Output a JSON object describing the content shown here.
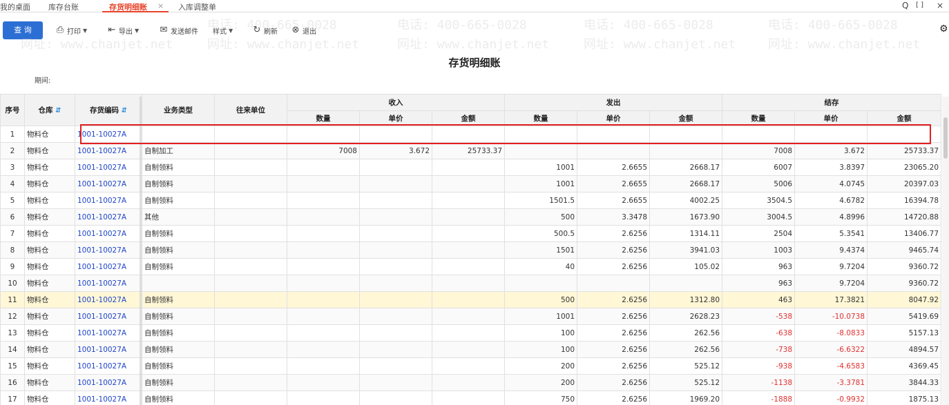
{
  "tabs": [
    {
      "label": "我的桌面"
    },
    {
      "label": "库存台账"
    },
    {
      "label": "存货明细账"
    },
    {
      "label": "入库调整单"
    }
  ],
  "tab_close": "×",
  "window_controls": {
    "search": "Q",
    "maximize": "[ ]",
    "close": "×"
  },
  "toolbar": {
    "query": "查 询",
    "print": "打印",
    "export": "导出",
    "send": "发送邮件",
    "style": "样式",
    "refresh": "刷新",
    "exit": "退出"
  },
  "report": {
    "title": "存货明细账",
    "period_label": "期间:"
  },
  "watermark": {
    "phone": "电话: 400-665-0028",
    "site": "网址: www.chanjet.net"
  },
  "columns": {
    "seq": "序号",
    "warehouse": "仓库",
    "code": "存货编码",
    "biz_type": "业务类型",
    "partner": "往来单位",
    "in": "收入",
    "out": "发出",
    "balance": "结存",
    "qty": "数量",
    "price": "单价",
    "amount": "金额"
  },
  "rows": [
    {
      "seq": "1",
      "wh": "物料仓",
      "code": "1001-10027A",
      "type": "",
      "partner": "",
      "in_qty": "",
      "in_price": "",
      "in_amt": "",
      "out_qty": "",
      "out_price": "",
      "out_amt": "",
      "bal_qty": "",
      "bal_price": "",
      "bal_amt": ""
    },
    {
      "seq": "2",
      "wh": "物料仓",
      "code": "1001-10027A",
      "type": "自制加工",
      "partner": "",
      "in_qty": "7008",
      "in_price": "3.672",
      "in_amt": "25733.37",
      "out_qty": "",
      "out_price": "",
      "out_amt": "",
      "bal_qty": "7008",
      "bal_price": "3.672",
      "bal_amt": "25733.37"
    },
    {
      "seq": "3",
      "wh": "物料仓",
      "code": "1001-10027A",
      "type": "自制领料",
      "partner": "",
      "in_qty": "",
      "in_price": "",
      "in_amt": "",
      "out_qty": "1001",
      "out_price": "2.6655",
      "out_amt": "2668.17",
      "bal_qty": "6007",
      "bal_price": "3.8397",
      "bal_amt": "23065.20"
    },
    {
      "seq": "4",
      "wh": "物料仓",
      "code": "1001-10027A",
      "type": "自制领料",
      "partner": "",
      "in_qty": "",
      "in_price": "",
      "in_amt": "",
      "out_qty": "1001",
      "out_price": "2.6655",
      "out_amt": "2668.17",
      "bal_qty": "5006",
      "bal_price": "4.0745",
      "bal_amt": "20397.03"
    },
    {
      "seq": "5",
      "wh": "物料仓",
      "code": "1001-10027A",
      "type": "自制领料",
      "partner": "",
      "in_qty": "",
      "in_price": "",
      "in_amt": "",
      "out_qty": "1501.5",
      "out_price": "2.6655",
      "out_amt": "4002.25",
      "bal_qty": "3504.5",
      "bal_price": "4.6782",
      "bal_amt": "16394.78"
    },
    {
      "seq": "6",
      "wh": "物料仓",
      "code": "1001-10027A",
      "type": "其他",
      "partner": "",
      "in_qty": "",
      "in_price": "",
      "in_amt": "",
      "out_qty": "500",
      "out_price": "3.3478",
      "out_amt": "1673.90",
      "bal_qty": "3004.5",
      "bal_price": "4.8996",
      "bal_amt": "14720.88"
    },
    {
      "seq": "7",
      "wh": "物料仓",
      "code": "1001-10027A",
      "type": "自制领料",
      "partner": "",
      "in_qty": "",
      "in_price": "",
      "in_amt": "",
      "out_qty": "500.5",
      "out_price": "2.6256",
      "out_amt": "1314.11",
      "bal_qty": "2504",
      "bal_price": "5.3541",
      "bal_amt": "13406.77"
    },
    {
      "seq": "8",
      "wh": "物料仓",
      "code": "1001-10027A",
      "type": "自制领料",
      "partner": "",
      "in_qty": "",
      "in_price": "",
      "in_amt": "",
      "out_qty": "1501",
      "out_price": "2.6256",
      "out_amt": "3941.03",
      "bal_qty": "1003",
      "bal_price": "9.4374",
      "bal_amt": "9465.74"
    },
    {
      "seq": "9",
      "wh": "物料仓",
      "code": "1001-10027A",
      "type": "自制领料",
      "partner": "",
      "in_qty": "",
      "in_price": "",
      "in_amt": "",
      "out_qty": "40",
      "out_price": "2.6256",
      "out_amt": "105.02",
      "bal_qty": "963",
      "bal_price": "9.7204",
      "bal_amt": "9360.72"
    },
    {
      "seq": "10",
      "wh": "物料仓",
      "code": "1001-10027A",
      "type": "",
      "partner": "",
      "in_qty": "",
      "in_price": "",
      "in_amt": "",
      "out_qty": "",
      "out_price": "",
      "out_amt": "",
      "bal_qty": "963",
      "bal_price": "9.7204",
      "bal_amt": "9360.72"
    },
    {
      "seq": "11",
      "wh": "物料仓",
      "code": "1001-10027A",
      "type": "自制领料",
      "partner": "",
      "in_qty": "",
      "in_price": "",
      "in_amt": "",
      "out_qty": "500",
      "out_price": "2.6256",
      "out_amt": "1312.80",
      "bal_qty": "463",
      "bal_price": "17.3821",
      "bal_amt": "8047.92"
    },
    {
      "seq": "12",
      "wh": "物料仓",
      "code": "1001-10027A",
      "type": "自制领料",
      "partner": "",
      "in_qty": "",
      "in_price": "",
      "in_amt": "",
      "out_qty": "1001",
      "out_price": "2.6256",
      "out_amt": "2628.23",
      "bal_qty": "-538",
      "bal_price": "-10.0738",
      "bal_amt": "5419.69"
    },
    {
      "seq": "13",
      "wh": "物料仓",
      "code": "1001-10027A",
      "type": "自制领料",
      "partner": "",
      "in_qty": "",
      "in_price": "",
      "in_amt": "",
      "out_qty": "100",
      "out_price": "2.6256",
      "out_amt": "262.56",
      "bal_qty": "-638",
      "bal_price": "-8.0833",
      "bal_amt": "5157.13"
    },
    {
      "seq": "14",
      "wh": "物料仓",
      "code": "1001-10027A",
      "type": "自制领料",
      "partner": "",
      "in_qty": "",
      "in_price": "",
      "in_amt": "",
      "out_qty": "100",
      "out_price": "2.6256",
      "out_amt": "262.56",
      "bal_qty": "-738",
      "bal_price": "-6.6322",
      "bal_amt": "4894.57"
    },
    {
      "seq": "15",
      "wh": "物料仓",
      "code": "1001-10027A",
      "type": "自制领料",
      "partner": "",
      "in_qty": "",
      "in_price": "",
      "in_amt": "",
      "out_qty": "200",
      "out_price": "2.6256",
      "out_amt": "525.12",
      "bal_qty": "-938",
      "bal_price": "-4.6583",
      "bal_amt": "4369.45"
    },
    {
      "seq": "16",
      "wh": "物料仓",
      "code": "1001-10027A",
      "type": "自制领料",
      "partner": "",
      "in_qty": "",
      "in_price": "",
      "in_amt": "",
      "out_qty": "200",
      "out_price": "2.6256",
      "out_amt": "525.12",
      "bal_qty": "-1138",
      "bal_price": "-3.3781",
      "bal_amt": "3844.33"
    },
    {
      "seq": "17",
      "wh": "物料仓",
      "code": "1001-10027A",
      "type": "自制领料",
      "partner": "",
      "in_qty": "",
      "in_price": "",
      "in_amt": "",
      "out_qty": "750",
      "out_price": "2.6256",
      "out_amt": "1969.20",
      "bal_qty": "-1888",
      "bal_price": "-0.9932",
      "bal_amt": "1875.13"
    }
  ],
  "highlighted_row": "11",
  "colors": {
    "accent": "#e8432a",
    "primary_button": "#2c6fd4",
    "code_link": "#1f45c7",
    "negative": "#e03030",
    "highlight_row": "#fff7d6",
    "annotation_box": "#e02020"
  }
}
